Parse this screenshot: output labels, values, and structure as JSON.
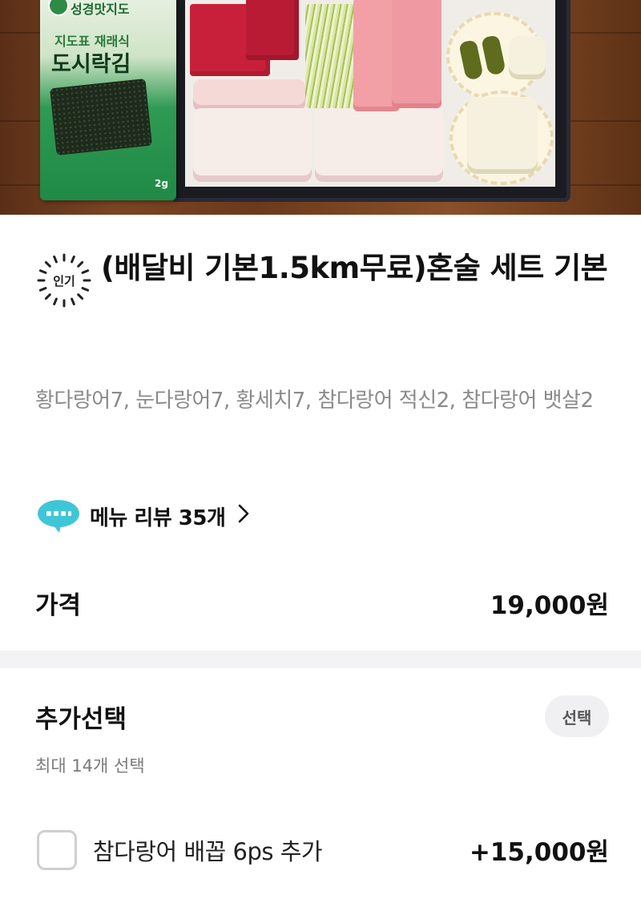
{
  "photo": {
    "alt_subject": "sashimi-set-photo",
    "seaweed_pack": {
      "brand": "성경맛지도",
      "subtitle": "지도표 재래식",
      "title": "도시락김",
      "weight": "2g"
    }
  },
  "menu": {
    "popular_badge": "인기",
    "title": "(배달비 기본1.5km무료)혼술 세트 기본",
    "description": "황다랑어7, 눈다랑어7, 황세치7, 참다랑어 적신2, 참다랑어 뱃살2",
    "review_link": "메뉴 리뷰 35개",
    "review_icon": "speech-bubble-icon",
    "chevron_icon": "chevron-right-icon"
  },
  "price": {
    "label": "가격",
    "value": "19,000원"
  },
  "options": {
    "title": "추가선택",
    "badge": "선택",
    "subtitle": "최대 14개 선택",
    "items": [
      {
        "name": "참다랑어 배꼽 6ps 추가",
        "price": "+15,000원",
        "checked": false
      }
    ]
  },
  "colors": {
    "text_primary": "#111111",
    "text_secondary": "#8a8a8a",
    "divider": "#f3f3f5",
    "badge_bg": "#f0f0f2",
    "review_icon": "#3fc6d6"
  }
}
